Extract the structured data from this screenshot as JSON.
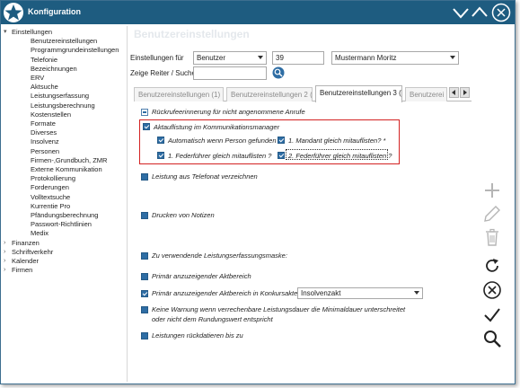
{
  "window": {
    "title": "Konfiguration"
  },
  "tree": {
    "root": "Einstellungen",
    "children": [
      "Benutzereinstellungen",
      "Programmgrundeinstellungen",
      "Telefonie",
      "Bezeichnungen",
      "ERV",
      "Aktsuche",
      "Leistungserfassung",
      "Leistungsberechnung",
      "Kostenstellen",
      "Formate",
      "Diverses",
      "Insolvenz",
      "Personen",
      "Firmen-,Grundbuch, ZMR",
      "Externe Kommunikation",
      "Protokollierung",
      "Forderungen",
      "Volltextsuche",
      "Kurrentie Pro",
      "Pfändungsberechnung",
      "Passwort-Richtlinien",
      "Medix"
    ],
    "collapsed": [
      "Finanzen",
      "Schriftverkehr",
      "Kalender",
      "Firmen"
    ]
  },
  "content": {
    "ghost_heading": "Benutzereinstellungen",
    "settings_for_label": "Einstellungen für",
    "settings_for_value": "Benutzer",
    "user_id": "39",
    "user_name": "Mustermann Moritz",
    "show_tab_label": "Zeige Reiter / Suche",
    "search_value": "",
    "tabs": [
      "Benutzereinstellungen (1)",
      "Benutzereinstellungen 2 (2)",
      "Benutzereinstellungen 3 (3)",
      "Benutzerei"
    ],
    "options": {
      "recall": "Rückrufeerinnerung für nicht angenommene Anrufe",
      "activity_list": "Aktauflistung im Kommunikationsmanager",
      "auto_person": "Automatisch wenn Person gefunden",
      "first_mandant": "1. Mandant gleich mitauflisten? *",
      "first_leader": "1. Federführer gleich mitauflisten ?",
      "second_leader": "2. Federführer gleich mitauflisten ?",
      "phone_service": "Leistung aus Telefonat verzeichnen",
      "print_notes": "Drucken von Notizen",
      "mask": "Zu verwendende Leistungserfassungsmaske:",
      "primary_area": "Primär anzuzeigender Aktbereich",
      "primary_insolvency": "Primär anzuzeigender Aktbereich in Konkursakten",
      "insolvency_value": "Insolvenzakt",
      "warning_line1": "Keine Warnung wenn verrechenbare Leistungsdauer die Minimaldauer unterschreitet",
      "warning_line2": "oder nicht dem Rundungswert entspricht",
      "backdate": "Leistungen rückdatieren bis zu"
    }
  },
  "toolbar_icons": [
    "add-icon",
    "edit-icon",
    "delete-icon",
    "refresh-icon",
    "cancel-icon",
    "confirm-icon",
    "search-icon"
  ],
  "colors": {
    "titlebar": "#1e5c80",
    "checkbox": "#2e6da4",
    "highlight": "#d32222"
  }
}
